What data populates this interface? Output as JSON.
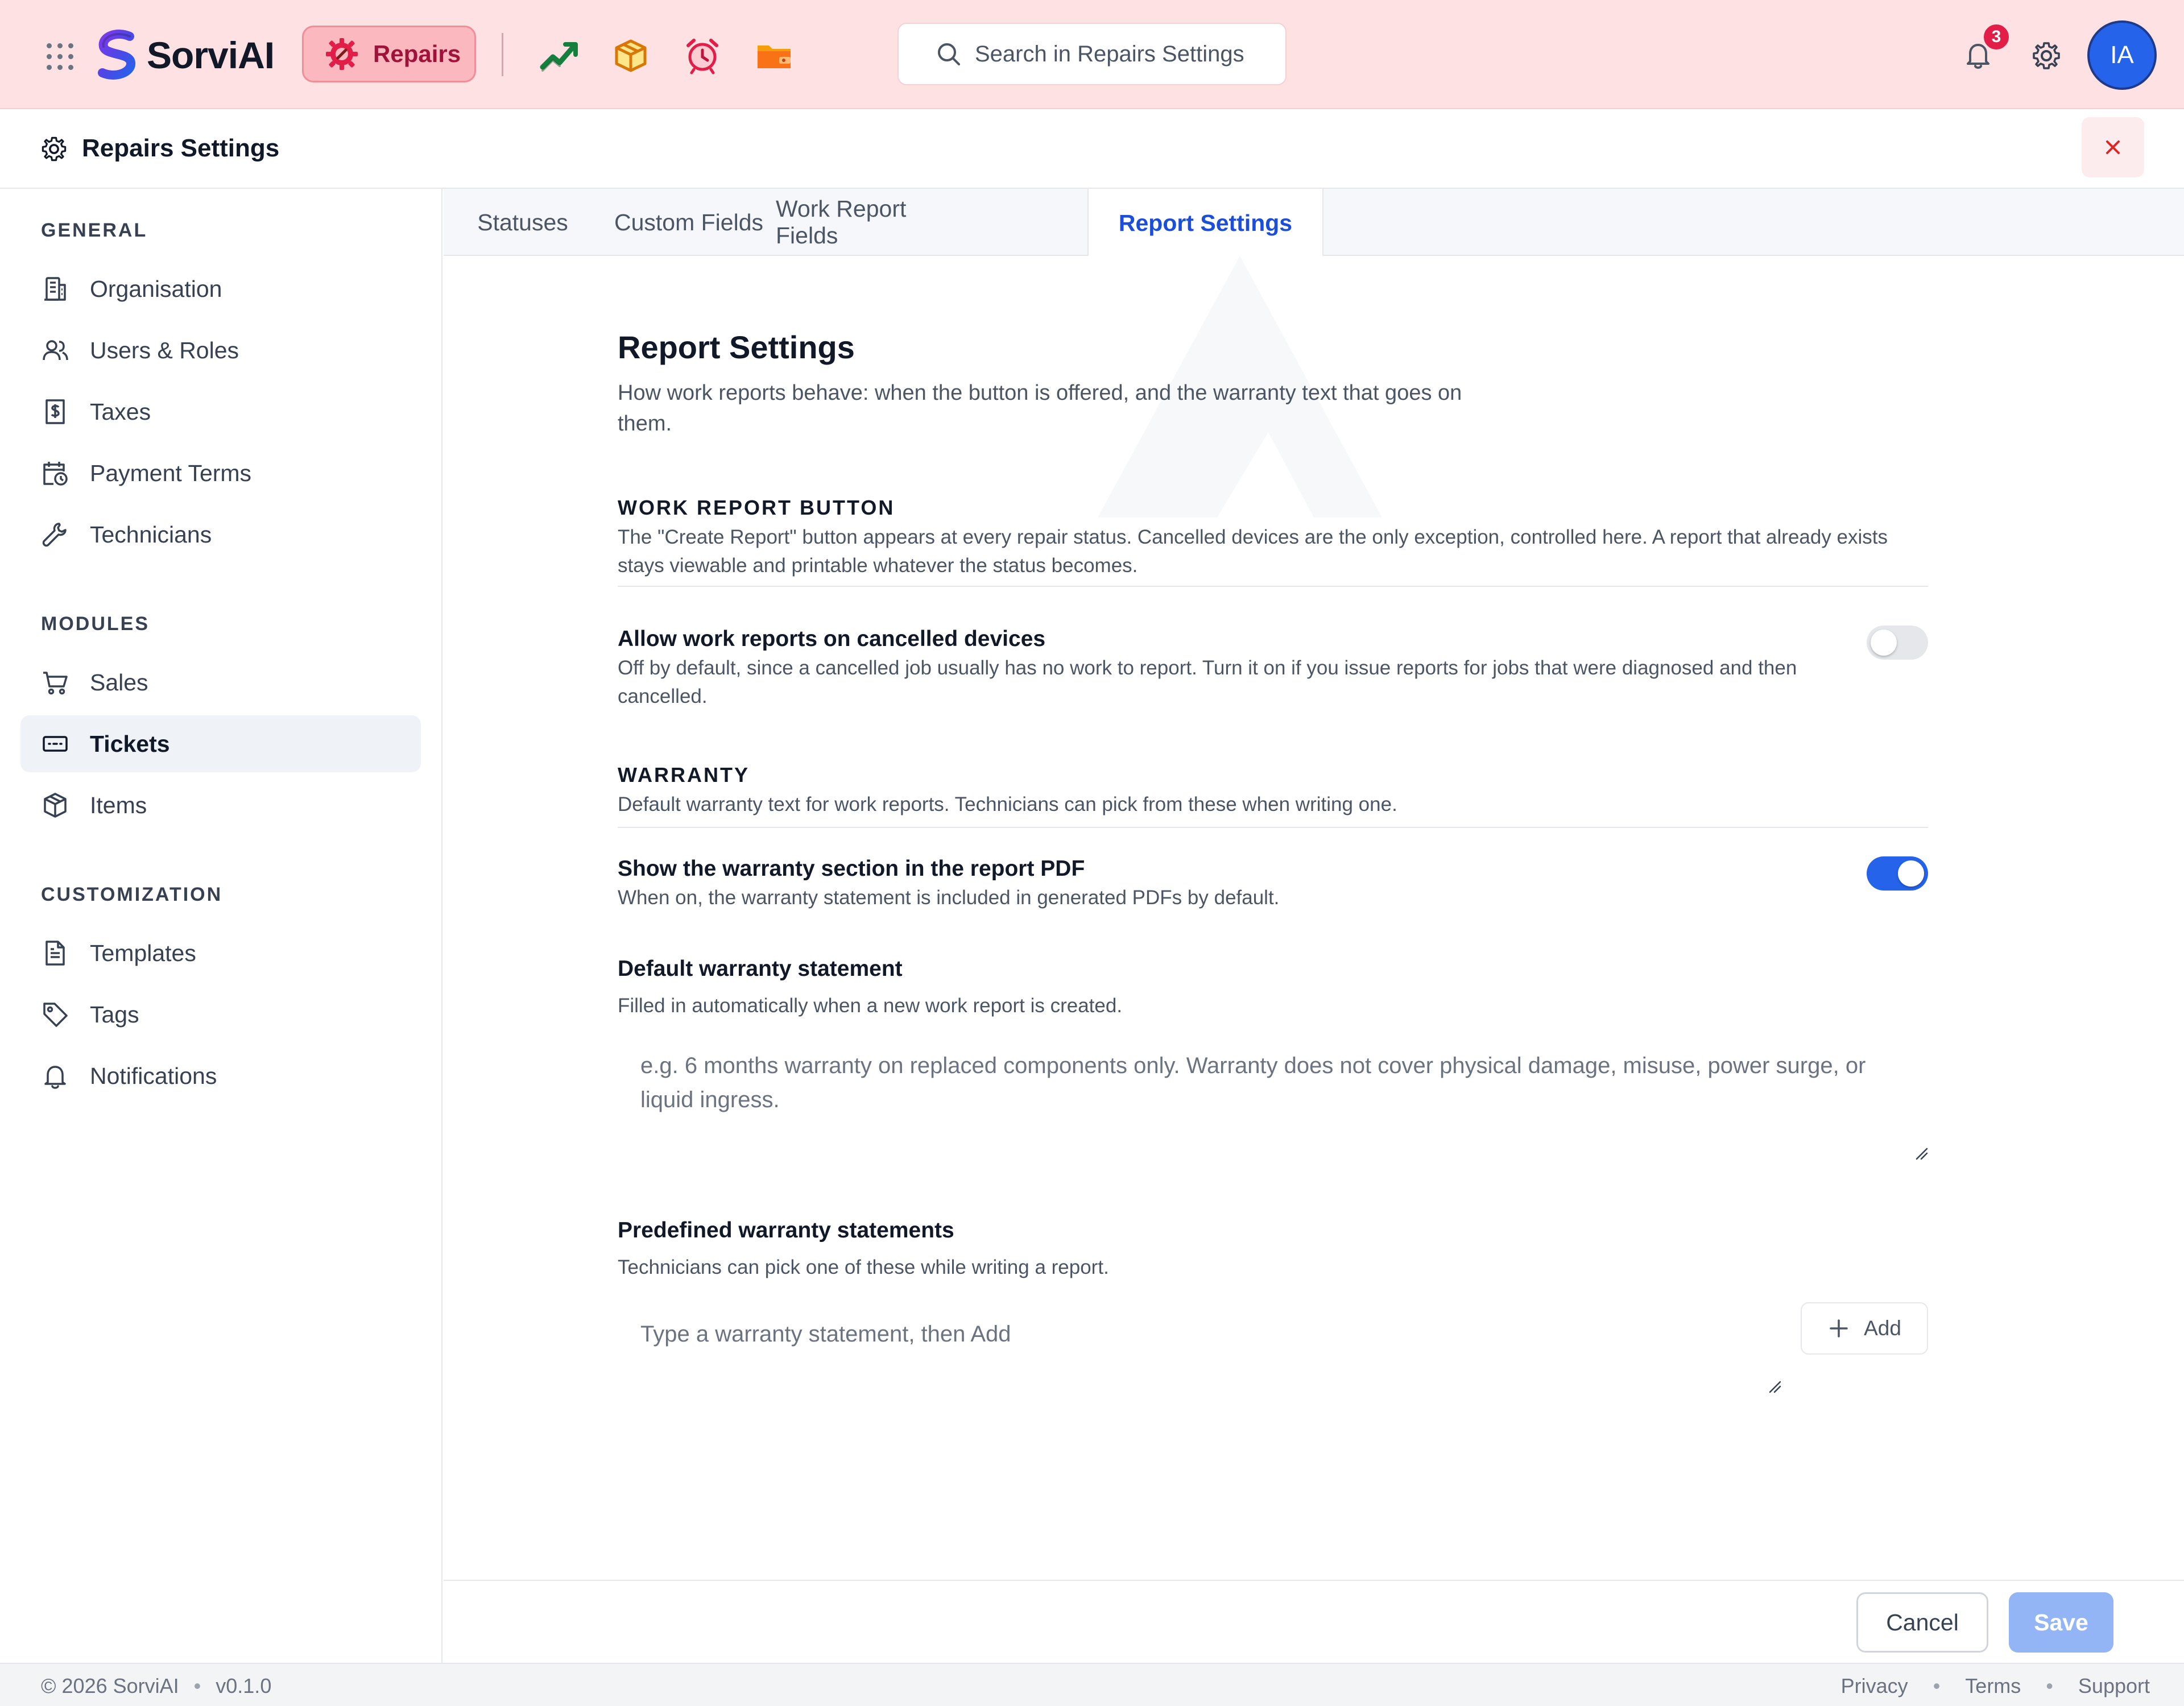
{
  "app": {
    "name": "SorviAI",
    "module": "Repairs",
    "search_placeholder": "Search in Repairs Settings",
    "notifications_count": "3",
    "user_initials": "IA",
    "apps": [
      "trending-chart-icon",
      "package-box-icon",
      "alarm-clock-icon",
      "folder-wallet-icon"
    ]
  },
  "header": {
    "title": "Repairs Settings"
  },
  "sidebar": {
    "sections": [
      {
        "title": "GENERAL",
        "items": [
          {
            "label": "Organisation",
            "icon": "building-icon"
          },
          {
            "label": "Users & Roles",
            "icon": "users-icon"
          },
          {
            "label": "Taxes",
            "icon": "dollar-receipt-icon"
          },
          {
            "label": "Payment Terms",
            "icon": "calendar-clock-icon"
          },
          {
            "label": "Technicians",
            "icon": "wrench-icon"
          }
        ]
      },
      {
        "title": "MODULES",
        "items": [
          {
            "label": "Sales",
            "icon": "cart-icon"
          },
          {
            "label": "Tickets",
            "icon": "ticket-icon",
            "active": true
          },
          {
            "label": "Items",
            "icon": "box-icon"
          }
        ]
      },
      {
        "title": "CUSTOMIZATION",
        "items": [
          {
            "label": "Templates",
            "icon": "document-icon"
          },
          {
            "label": "Tags",
            "icon": "tag-icon"
          },
          {
            "label": "Notifications",
            "icon": "bell-icon"
          }
        ]
      }
    ]
  },
  "tabs": [
    {
      "label": "Statuses"
    },
    {
      "label": "Custom Fields"
    },
    {
      "label": "Work Report Fields"
    },
    {
      "label": "Report Settings",
      "active": true
    }
  ],
  "page": {
    "title": "Report Settings",
    "lead": "How work reports behave: when the button is offered, and the warranty text that goes on them.",
    "work_report_button": {
      "heading": "WORK REPORT BUTTON",
      "description": "The \"Create Report\" button appears at every repair status. Cancelled devices are the only exception, controlled here. A report that already exists stays viewable and printable whatever the status becomes.",
      "allow_cancelled": {
        "title": "Allow work reports on cancelled devices",
        "description": "Off by default, since a cancelled job usually has no work to report. Turn it on if you issue reports for jobs that were diagnosed and then cancelled.",
        "enabled": false
      }
    },
    "warranty": {
      "heading": "WARRANTY",
      "description": "Default warranty text for work reports. Technicians can pick from these when writing one.",
      "show_in_pdf": {
        "title": "Show the warranty section in the report PDF",
        "description": "When on, the warranty statement is included in generated PDFs by default.",
        "enabled": true
      },
      "default_statement": {
        "title": "Default warranty statement",
        "description": "Filled in automatically when a new work report is created.",
        "placeholder": "e.g. 6 months warranty on replaced components only. Warranty does not cover physical damage, misuse, power surge, or liquid ingress."
      },
      "predefined": {
        "title": "Predefined warranty statements",
        "description": "Technicians can pick one of these while writing a report.",
        "placeholder": "Type a warranty statement, then Add",
        "add_label": "Add"
      }
    }
  },
  "actions": {
    "cancel_label": "Cancel",
    "save_label": "Save"
  },
  "footer": {
    "copyright": "© 2026 SorviAI",
    "version": "v0.1.0",
    "links": [
      "Privacy",
      "Terms",
      "Support"
    ]
  },
  "colors": {
    "topbar_bg": "#fde1e3",
    "accent": "#2563eb",
    "module_accent": "#9f1239"
  }
}
